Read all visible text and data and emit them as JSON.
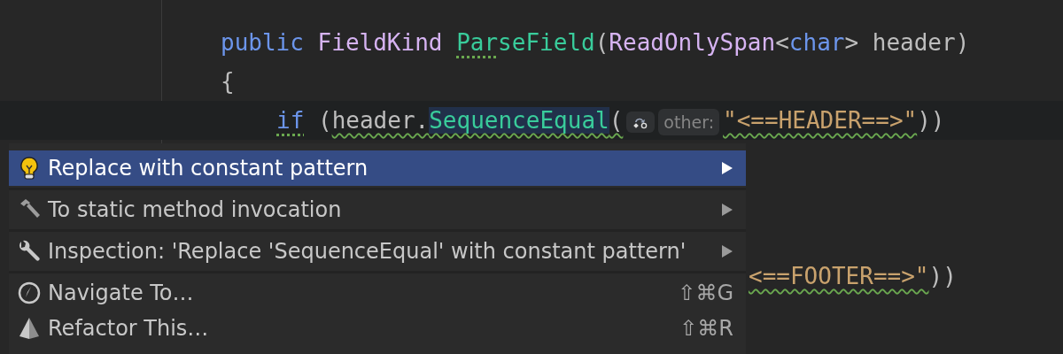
{
  "editor": {
    "lines": [
      {
        "current": false,
        "tokens": [
          {
            "text": "public ",
            "kind": "keyword"
          },
          {
            "text": "FieldKind ",
            "kind": "type"
          },
          {
            "text": "Par",
            "kind": "method",
            "hint": true
          },
          {
            "text": "seField",
            "kind": "method"
          },
          {
            "text": "(",
            "kind": "plain"
          },
          {
            "text": "ReadOnlySpan",
            "kind": "type"
          },
          {
            "text": "<",
            "kind": "plain"
          },
          {
            "text": "char",
            "kind": "keyword"
          },
          {
            "text": "> header)",
            "kind": "plain"
          }
        ]
      },
      {
        "current": false,
        "tokens": [
          {
            "text": "{",
            "kind": "plain"
          }
        ],
        "children": [
          {
            "current": true,
            "tokens": [
              {
                "text": "if",
                "kind": "keyword",
                "hint": true
              },
              {
                "text": " (",
                "kind": "plain"
              },
              {
                "text": "header.",
                "kind": "plain",
                "warning": true
              },
              {
                "text": "SequenceEqual",
                "kind": "method",
                "warning": true,
                "highlighted": true
              },
              {
                "text": "(",
                "kind": "plain",
                "warning": true
              },
              {
                "text": "other:",
                "kind": "parameter-hint"
              },
              {
                "text": "\"<==HEADER==>\"",
                "kind": "string",
                "warning": true
              },
              {
                "text": "))",
                "kind": "plain"
              }
            ]
          }
        ]
      },
      {
        "current": false,
        "partial": true,
        "tokens": [
          {
            "text": "<==FOOTER==>\"",
            "kind": "string",
            "warning": true
          },
          {
            "text": "))",
            "kind": "plain"
          }
        ]
      }
    ]
  },
  "menu": {
    "groups": [
      [
        {
          "label": "Replace with constant pattern",
          "kind": "quick-fix",
          "submenu": true,
          "selected": true
        }
      ],
      [
        {
          "label": "To static method invocation",
          "kind": "context-action",
          "submenu": true,
          "selected": false
        }
      ],
      [
        {
          "label": "Inspection: 'Replace 'SequenceEqual' with constant pattern'",
          "kind": "inspection",
          "submenu": true,
          "selected": false
        }
      ],
      [
        {
          "label": "Navigate To…",
          "kind": "navigate",
          "shortcut": "⇧⌘G",
          "selected": false
        },
        {
          "label": "Refactor This…",
          "kind": "refactor",
          "shortcut": "⇧⌘R",
          "selected": false
        }
      ]
    ]
  }
}
